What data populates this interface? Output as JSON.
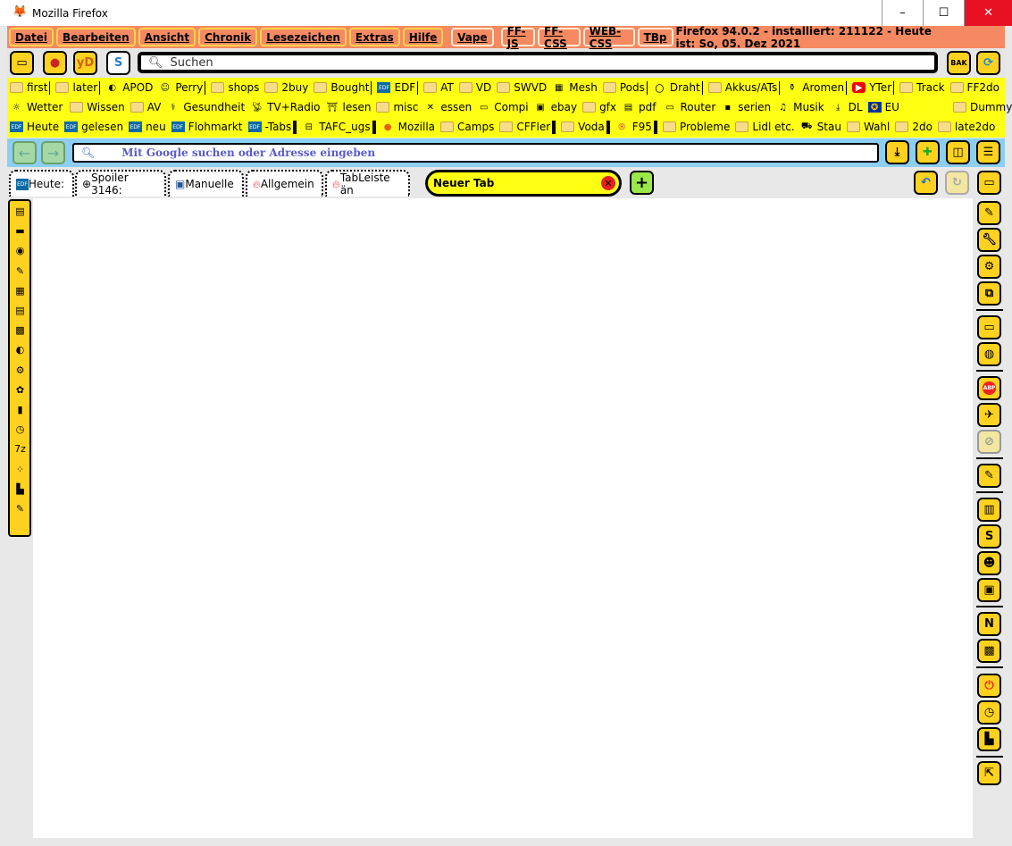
{
  "window": {
    "title": "Mozilla Firefox",
    "minimize": "–",
    "maximize": "☐",
    "close": "✕"
  },
  "menubar": {
    "items": [
      "Datei",
      "Bearbeiten",
      "Ansicht",
      "Chronik",
      "Lesezeichen",
      "Extras",
      "Hilfe"
    ],
    "extra": [
      "Vape",
      "FF-JS",
      "FF-CSS",
      "WEB-CSS",
      "TBp"
    ],
    "info": "Firefox 94.0.2 - installiert:  211122 - Heute ist:  So, 05. Dez 2021"
  },
  "toolbar": {
    "search_placeholder": "Suchen",
    "yd_label": "yD"
  },
  "bookmarks": {
    "rows": [
      [
        {
          "l": "first",
          "i": "folder",
          "s": 1
        },
        {
          "l": "later",
          "i": "folder",
          "s": 1
        },
        {
          "l": "APOD",
          "i": "apod",
          "s": 0
        },
        {
          "l": "Perry",
          "i": "perry",
          "s": 1
        },
        {
          "l": "shops",
          "i": "folder",
          "s": 0
        },
        {
          "l": "2buy",
          "i": "folder",
          "s": 0
        },
        {
          "l": "Bought",
          "i": "folder",
          "s": 1
        },
        {
          "l": "EDF",
          "i": "edf",
          "s": 1
        },
        {
          "l": "AT",
          "i": "folder",
          "s": 0
        },
        {
          "l": "VD",
          "i": "folder",
          "s": 0
        },
        {
          "l": "SWVD",
          "i": "folder",
          "s": 0
        },
        {
          "l": "Mesh",
          "i": "grid",
          "s": 0
        },
        {
          "l": "Pods",
          "i": "folder",
          "s": 1
        },
        {
          "l": "Draht",
          "i": "coil",
          "s": 1
        },
        {
          "l": "Akkus/ATs",
          "i": "folder",
          "s": 1
        },
        {
          "l": "Aromen",
          "i": "bottles",
          "s": 1
        },
        {
          "l": "YTer",
          "i": "youtube",
          "s": 1
        },
        {
          "l": "Track",
          "i": "folder",
          "s": 0
        },
        {
          "l": "FF2do",
          "i": "folder",
          "s": 0
        }
      ],
      [
        {
          "l": "Wetter",
          "i": "sun",
          "s": 1
        },
        {
          "l": "Wissen",
          "i": "folder",
          "s": 0
        },
        {
          "l": "AV",
          "i": "folder",
          "s": 0
        },
        {
          "l": "Gesundheit",
          "i": "health",
          "s": 0
        },
        {
          "l": "TV+Radio",
          "i": "antenna",
          "s": 0
        },
        {
          "l": "lesen",
          "i": "book",
          "s": 0
        },
        {
          "l": "misc",
          "i": "folder",
          "s": 0
        },
        {
          "l": "essen",
          "i": "cutlery",
          "s": 0
        },
        {
          "l": "Compi",
          "i": "computer",
          "s": 0
        },
        {
          "l": "ebay",
          "i": "bag",
          "s": 0
        },
        {
          "l": "gfx",
          "i": "folder",
          "s": 0
        },
        {
          "l": "pdf",
          "i": "pdf",
          "s": 1
        },
        {
          "l": "Router",
          "i": "router",
          "s": 0
        },
        {
          "l": "serien",
          "i": "tv",
          "s": 0
        },
        {
          "l": "Musik",
          "i": "music",
          "s": 1
        },
        {
          "l": "DL",
          "i": "download",
          "s": 0
        },
        {
          "l": "EU",
          "i": "eu",
          "s": 0
        },
        {
          "l": "Dummy",
          "i": "folder",
          "s": 0
        }
      ],
      [
        {
          "l": "Heute",
          "i": "edf",
          "s": 0
        },
        {
          "l": "gelesen",
          "i": "edf",
          "s": 0
        },
        {
          "l": "neu",
          "i": "edf",
          "s": 0
        },
        {
          "l": "Flohmarkt",
          "i": "edf",
          "s": 0
        },
        {
          "l": "-Tabs",
          "i": "edf",
          "s": 1
        },
        {
          "l": "TAFC_ugs",
          "i": "drive",
          "s": 1
        },
        {
          "l": "Mozilla",
          "i": "firefox",
          "s": 0
        },
        {
          "l": "Camps",
          "i": "folder",
          "s": 0
        },
        {
          "l": "CFFler",
          "i": "folder",
          "s": 1
        },
        {
          "l": "Voda",
          "i": "folder",
          "s": 1
        },
        {
          "l": "F95",
          "i": "f95",
          "s": 1
        },
        {
          "l": "Probleme",
          "i": "folder",
          "s": 0
        },
        {
          "l": "Lidl etc.",
          "i": "folder",
          "s": 0
        },
        {
          "l": "Stau",
          "i": "car",
          "s": 0
        },
        {
          "l": "Wahl",
          "i": "folder",
          "s": 0
        },
        {
          "l": "2do",
          "i": "folder",
          "s": 0
        },
        {
          "l": "late2do",
          "i": "folder",
          "s": 0
        }
      ]
    ]
  },
  "navbar": {
    "url_placeholder": "Mit Google suchen oder Adresse eingeben"
  },
  "tabs": [
    {
      "label": "Heute:",
      "icon": "edf"
    },
    {
      "label": "Spoiler 3146:",
      "icon": "globe"
    },
    {
      "label": "Manuelle",
      "icon": "manual"
    },
    {
      "label": "Allgemein",
      "icon": "flame"
    },
    {
      "label": "TabLeiste än",
      "icon": "flame"
    }
  ],
  "active_tab": {
    "label": "Neuer Tab"
  },
  "colors": {
    "menubar": "#f58a62",
    "bookmarks": "#ffff14",
    "navbar": "#8ccff2",
    "button": "#ffd21f"
  }
}
